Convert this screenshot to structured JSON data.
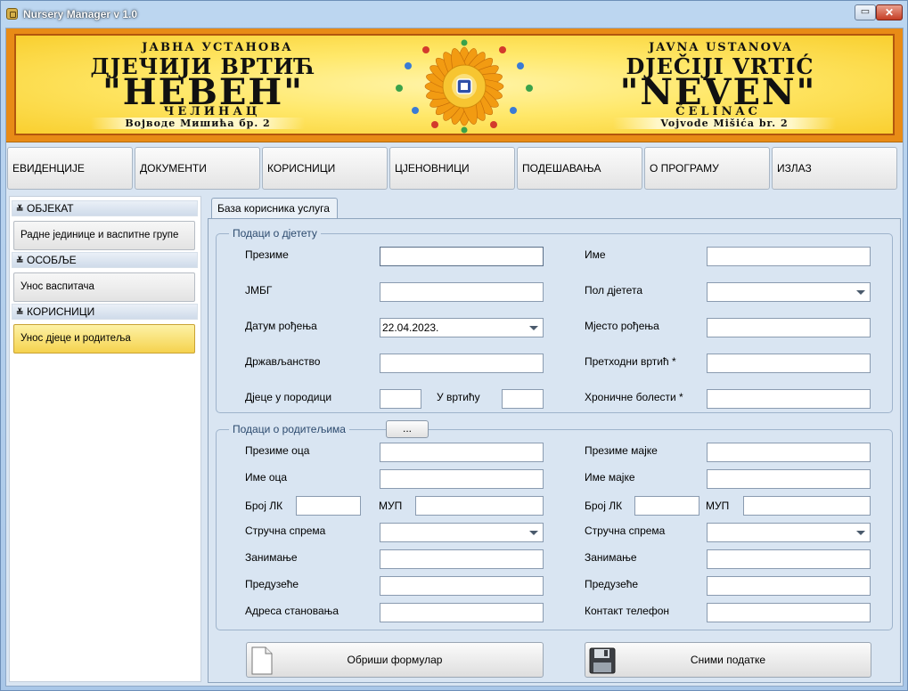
{
  "window": {
    "title": "Nursery Manager  v 1.0",
    "minimize_glyph": "▭",
    "close_glyph": "✕"
  },
  "banner": {
    "left_line1": "ЈАВНА УСТАНОВА",
    "left_line2": "ДЈЕЧИЈИ ВРТИЋ",
    "left_line3": "\"НЕВЕН\"",
    "left_line4": "ЧЕЛИНАЦ",
    "left_line5": "Војводе Мишића бр. 2",
    "right_line1": "JAVNA USTANOVA",
    "right_line2": "DJEČIJI VRTIĆ",
    "right_line3": "\"NEVEN\"",
    "right_line4": "ČELINAC",
    "right_line5": "Vojvode Mišića br. 2",
    "colors": {
      "frame": "#e88b16",
      "petals": "#f29b12",
      "center": "#f7c531"
    }
  },
  "menu": [
    "ЕВИДЕНЦИЈЕ",
    "ДОКУМЕНТИ",
    "КОРИСНИЦИ",
    "ЦЈЕНОВНИЦИ",
    "ПОДЕШАВАЊА",
    "О ПРОГРАМУ",
    "ИЗЛАЗ"
  ],
  "sidebar": {
    "sections": [
      {
        "title": "ОБЈЕКАТ",
        "items": [
          "Радне јединице и васпитне групе"
        ]
      },
      {
        "title": "ОСОБЉЕ",
        "items": [
          "Унос васпитача"
        ]
      },
      {
        "title": "КОРИСНИЦИ",
        "items": [
          "Унос дјеце и родитеља"
        ]
      }
    ],
    "chevron": "≚",
    "active_item": "Унос дјеце и родитеља"
  },
  "main": {
    "tab": "База корисника услуга",
    "child_group": {
      "title": "Подаци о дјетету",
      "surname": "Презиме",
      "name": "Име",
      "jmbg": "ЈМБГ",
      "gender": "Пол дјетета",
      "gender_value": "",
      "birth_date": "Датум рођења",
      "birth_date_value": "22.04.2023.",
      "birth_place": "Мјесто рођења",
      "citizenship": "Држављанство",
      "prev_kindergarten": "Претходни вртић *",
      "children_in_family": "Дјеце у породици",
      "in_kindergarten": "У вртићу",
      "chronic_diseases": "Хроничне болести *"
    },
    "parents_group": {
      "title": "Подаци о родитељима",
      "dots_label": "...",
      "father_surname": "Презиме оца",
      "mother_surname": "Презиме мајке",
      "father_name": "Име оца",
      "mother_name": "Име мајке",
      "id_card": "Број ЛК",
      "mup": "МУП",
      "education": "Стручна спрема",
      "occupation": "Занимање",
      "company": "Предузеће",
      "address": "Адреса становања",
      "phone": "Контакт телефон"
    },
    "buttons": {
      "clear": "Обриши формулар",
      "save": "Сними податке"
    }
  }
}
